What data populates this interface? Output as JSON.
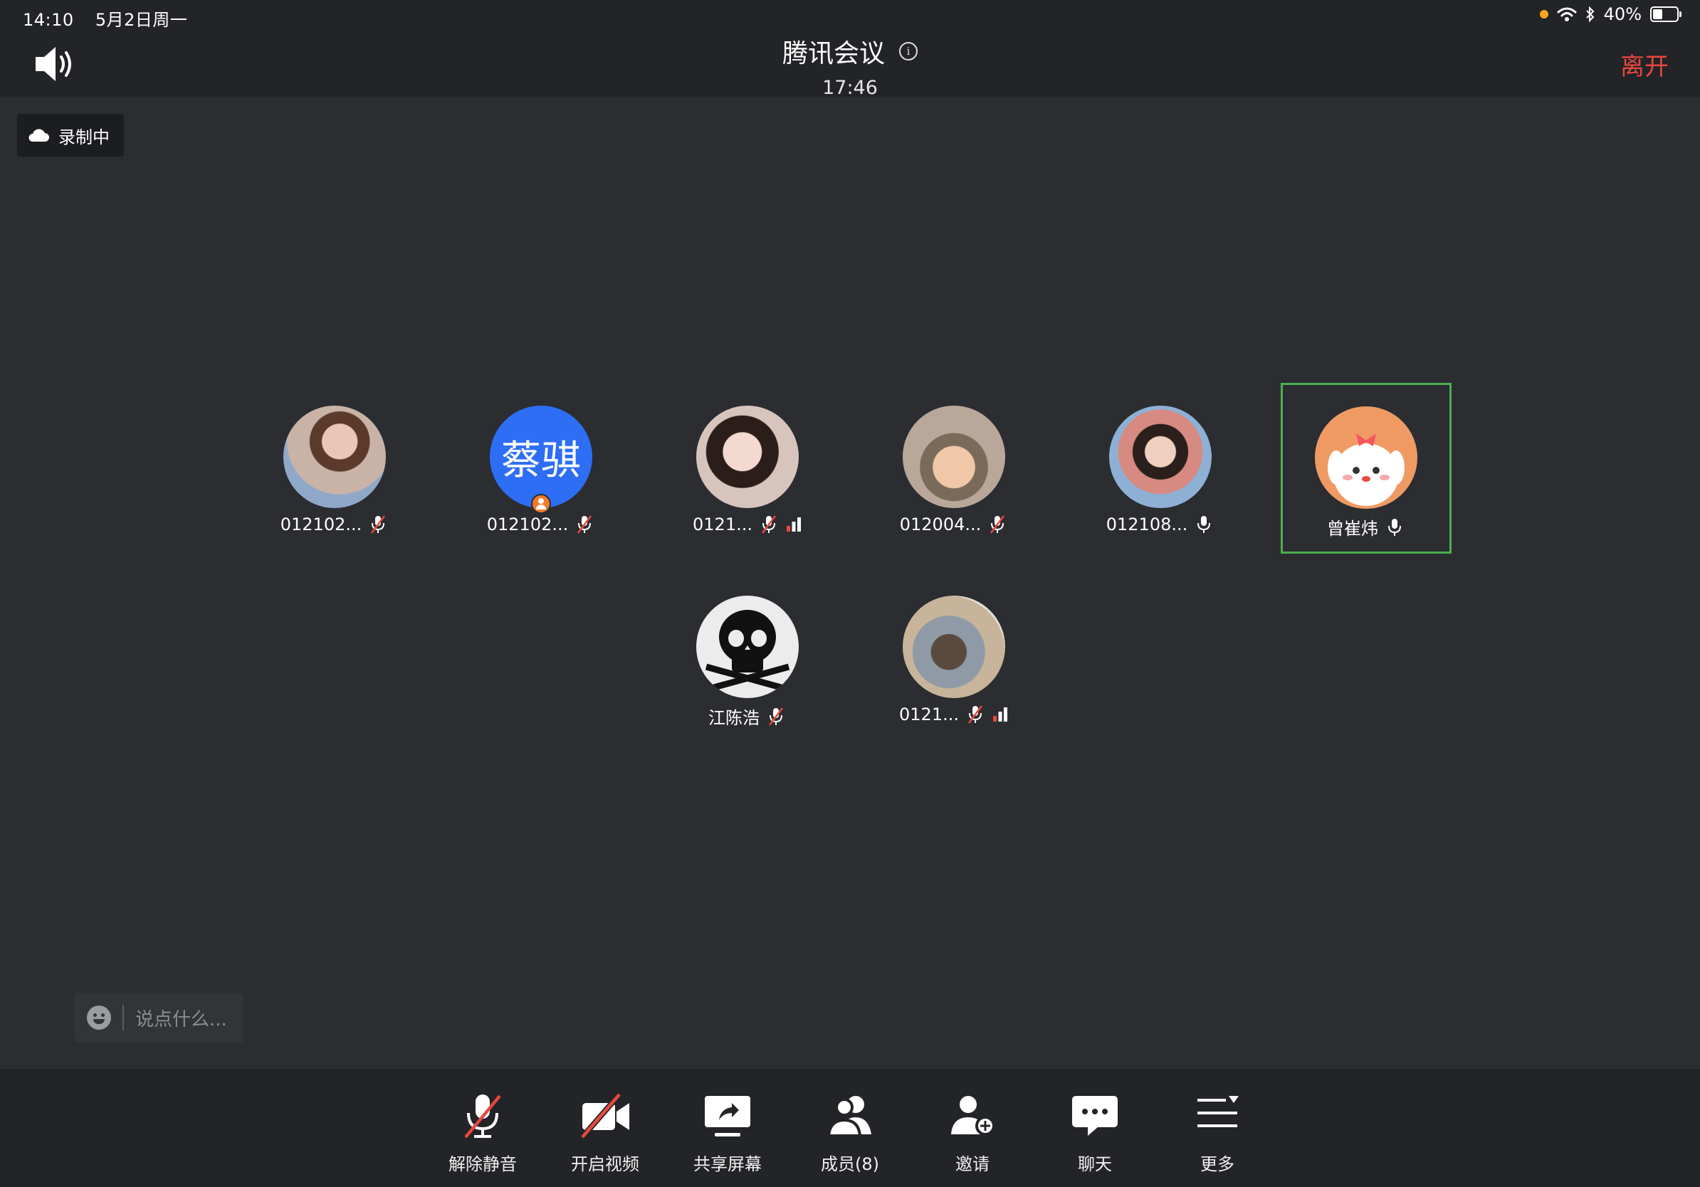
{
  "status_bar": {
    "time": "14:10",
    "date": "5月2日周一",
    "battery": "40%",
    "battery_level": 0.4
  },
  "header": {
    "title": "腾讯会议",
    "timer": "17:46",
    "leave_label": "离开"
  },
  "recording": {
    "label": "录制中"
  },
  "participants": [
    {
      "name": "012102...",
      "mic": "muted"
    },
    {
      "name": "012102...",
      "mic": "muted",
      "avatar_text": "蔡骐",
      "host": true
    },
    {
      "name": "0121...",
      "mic": "muted",
      "signal": "weak"
    },
    {
      "name": "012004...",
      "mic": "muted"
    },
    {
      "name": "012108...",
      "mic": "on"
    },
    {
      "name": "曾崔炜",
      "mic": "on",
      "active_speaker": true
    },
    {
      "name": "江陈浩",
      "mic": "muted"
    },
    {
      "name": "0121...",
      "mic": "muted",
      "signal": "weak"
    }
  ],
  "chat": {
    "placeholder": "说点什么..."
  },
  "toolbar": {
    "unmute": "解除静音",
    "start_video": "开启视频",
    "share_screen": "共享屏幕",
    "members": "成员(8)",
    "invite": "邀请",
    "chat": "聊天",
    "more": "更多"
  },
  "colors": {
    "background": "#2b2d31",
    "bar": "#232427",
    "leave": "#e8483f",
    "active_border": "#4caf50",
    "avatar_blue": "#2d6ef5",
    "mute_red": "#e8483f"
  }
}
